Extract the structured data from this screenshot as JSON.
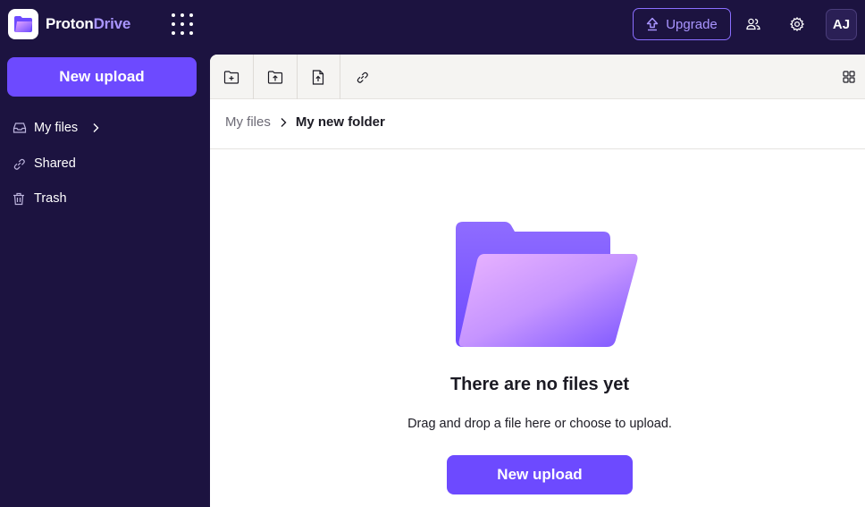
{
  "header": {
    "brand_proton": "Proton",
    "brand_drive": "Drive",
    "upgrade_label": "Upgrade",
    "avatar_initials": "AJ"
  },
  "sidebar": {
    "new_upload_label": "New upload",
    "items": [
      {
        "label": "My files",
        "icon": "inbox-icon"
      },
      {
        "label": "Shared",
        "icon": "link-icon"
      },
      {
        "label": "Trash",
        "icon": "trash-icon"
      }
    ]
  },
  "toolbar": {
    "buttons": [
      "new-folder-icon",
      "upload-folder-icon",
      "upload-file-icon",
      "share-link-icon"
    ],
    "view_toggle": "grid-icon"
  },
  "breadcrumb": {
    "parent": "My files",
    "current": "My new folder"
  },
  "empty_state": {
    "title": "There are no files yet",
    "subtitle": "Drag and drop a file here or choose to upload.",
    "button_label": "New upload"
  },
  "colors": {
    "sidebar_bg": "#1c1340",
    "accent": "#6d4aff",
    "accent_light": "#a995ff",
    "toolbar_bg": "#f5f4f2"
  }
}
